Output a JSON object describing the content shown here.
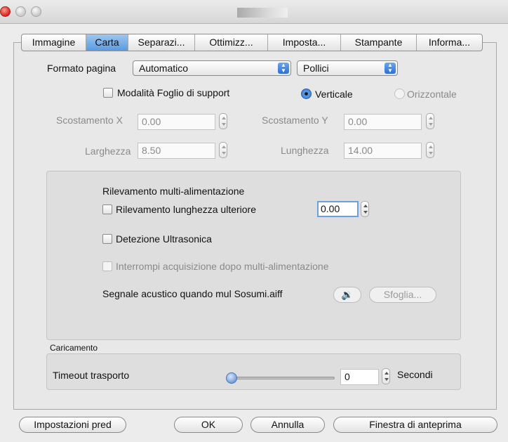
{
  "window": {
    "title_graphic": ""
  },
  "tabs": [
    {
      "label": "Immagine"
    },
    {
      "label": "Carta"
    },
    {
      "label": "Separazi..."
    },
    {
      "label": "Ottimizz..."
    },
    {
      "label": "Imposta..."
    },
    {
      "label": "Stampante"
    },
    {
      "label": "Informa..."
    }
  ],
  "active_tab": "Carta",
  "page": {
    "format_label": "Formato pagina",
    "format_value": "Automatico",
    "unit_value": "Pollici",
    "carrier_mode_label": "Modalità Foglio di support",
    "carrier_mode_checked": false,
    "orientation": {
      "portrait_label": "Verticale",
      "landscape_label": "Orizzontale",
      "selected": "Verticale"
    },
    "offset_x_label": "Scostamento X",
    "offset_x_value": "0.00",
    "offset_y_label": "Scostamento Y",
    "offset_y_value": "0.00",
    "width_label": "Larghezza",
    "width_value": "8.50",
    "length_label": "Lunghezza",
    "length_value": "14.00"
  },
  "multifeed": {
    "heading": "Rilevamento multi-alimentazione",
    "length_detection_label": "Rilevamento lunghezza ulteriore",
    "length_detection_checked": false,
    "length_detection_value": "0.00",
    "ultrasonic_label": "Detezione Ultrasonica",
    "ultrasonic_checked": false,
    "stop_after_label": "Interrompi acquisizione dopo multi-alimentazione",
    "stop_after_checked": false,
    "sound_label": "Segnale acustico quando mul Sosumi.aiff",
    "play_icon": "speaker-icon",
    "browse_label": "Sfoglia..."
  },
  "loading": {
    "heading": "Caricamento",
    "timeout_label": "Timeout trasporto",
    "timeout_value": "0",
    "unit_label": "Secondi"
  },
  "footer": {
    "defaults_label": "Impostazioni pred",
    "ok_label": "OK",
    "cancel_label": "Annulla",
    "preview_label": "Finestra di anteprima"
  },
  "colors": {
    "accent": "#5a9ae0",
    "close_button": "#d6221d"
  }
}
